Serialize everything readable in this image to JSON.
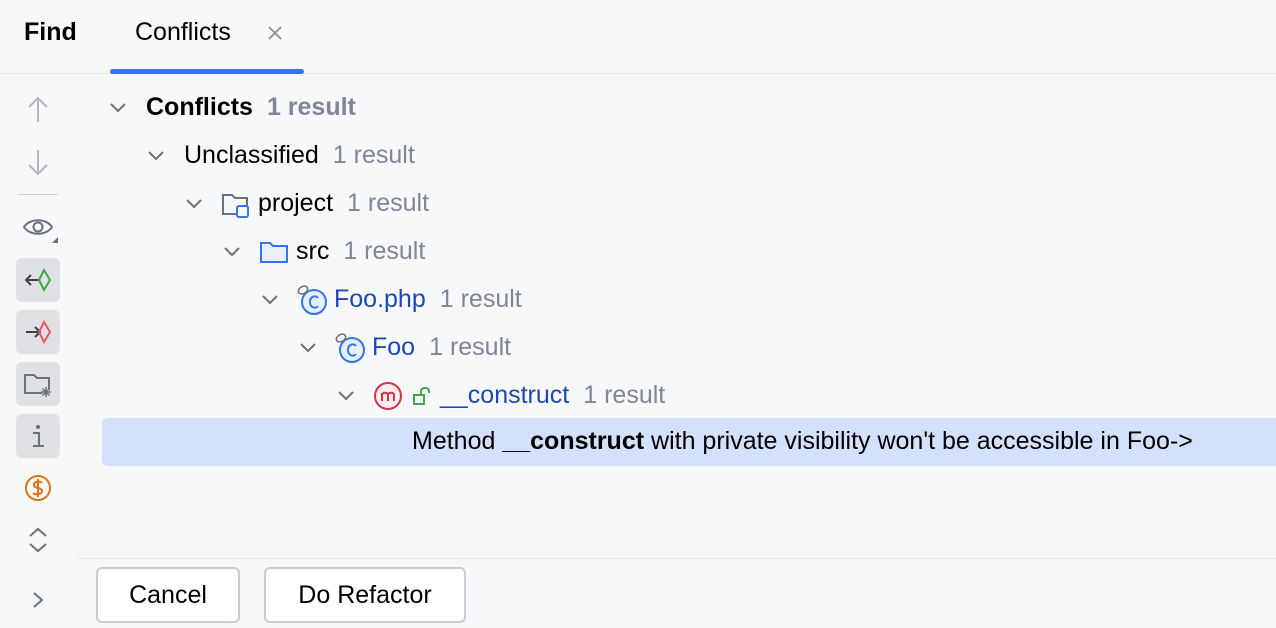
{
  "tabs": {
    "find_label": "Find",
    "conflicts_label": "Conflicts"
  },
  "toolbar": {
    "icons": [
      "arrow-up-icon",
      "arrow-down-icon",
      "eye-icon",
      "import-icon",
      "export-icon",
      "folder-settings-icon",
      "info-icon",
      "dollar-icon",
      "expand-collapse-icon",
      "chevron-right-icon"
    ]
  },
  "tree": {
    "root": {
      "label": "Conflicts",
      "count": "1 result"
    },
    "unclassified": {
      "label": "Unclassified",
      "count": "1 result"
    },
    "project": {
      "label": "project",
      "count": "1 result"
    },
    "src": {
      "label": "src",
      "count": "1 result"
    },
    "file": {
      "label": "Foo.php",
      "count": "1 result"
    },
    "class": {
      "label": "Foo",
      "count": "1 result"
    },
    "method": {
      "label": "__construct",
      "count": "1 result"
    },
    "message": {
      "prefix": "Method ",
      "name": "__construct",
      "suffix": " with private visibility won't be accessible in Foo->"
    }
  },
  "buttons": {
    "cancel": "Cancel",
    "do_refactor": "Do Refactor"
  },
  "colors": {
    "accent": "#3574f0",
    "link": "#1d47b6",
    "selection": "#d5e1fc",
    "muted": "#818594",
    "method_icon": "#d6304a",
    "dollar_icon": "#e0720f"
  }
}
